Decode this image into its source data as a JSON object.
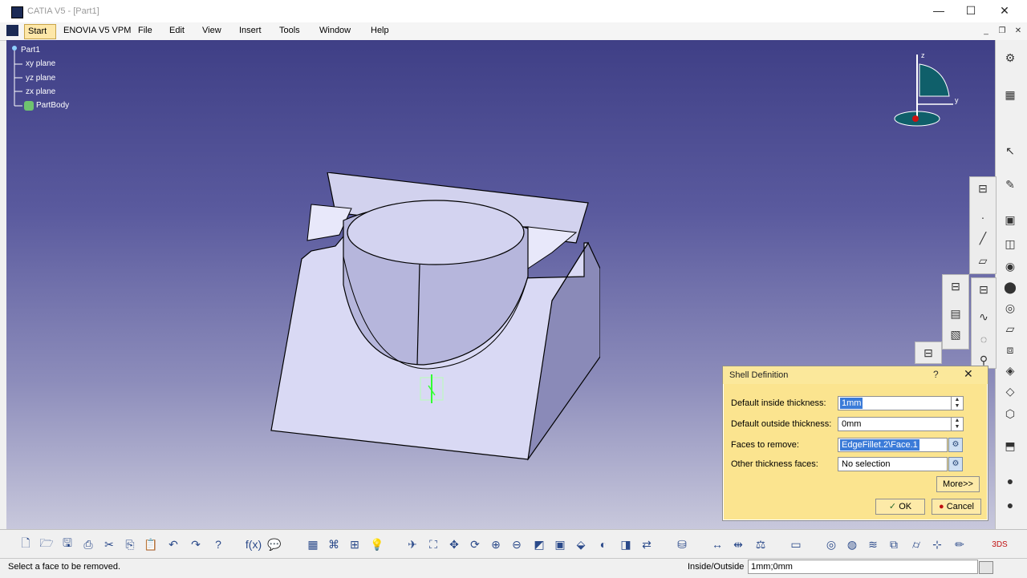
{
  "window": {
    "title": "CATIA V5 - [Part1]",
    "minimize": "—",
    "maximize": "☐",
    "close": "✕"
  },
  "menu": {
    "start": "Start",
    "items": [
      "ENOVIA V5 VPM",
      "File",
      "Edit",
      "View",
      "Insert",
      "Tools",
      "Window",
      "Help"
    ]
  },
  "tree": {
    "root": "Part1",
    "children": [
      "xy plane",
      "yz plane",
      "zx plane",
      "PartBody"
    ]
  },
  "compass": {
    "z": "z",
    "y": "y"
  },
  "dialog": {
    "title": "Shell Definition",
    "help": "?",
    "close": "✕",
    "inside_label": "Default inside thickness:",
    "inside_value": "1mm",
    "outside_label": "Default outside thickness:",
    "outside_value": "0mm",
    "faces_remove_label": "Faces to remove:",
    "faces_remove_value": "EdgeFillet.2\\Face.1",
    "other_faces_label": "Other thickness faces:",
    "other_faces_value": "No selection",
    "more_label": "More>>",
    "ok_label": "OK",
    "cancel_label": "Cancel"
  },
  "status": {
    "message": "Select a face to be removed.",
    "io_label": "Inside/Outside",
    "io_value": "1mm;0mm"
  },
  "colors": {
    "bg_top": "#3f3f86",
    "bg_bottom": "#c8c8dc",
    "part_face": "#d6d6f2",
    "dialog_bg": "#fbe48f",
    "selection": "#3b7bd8"
  }
}
